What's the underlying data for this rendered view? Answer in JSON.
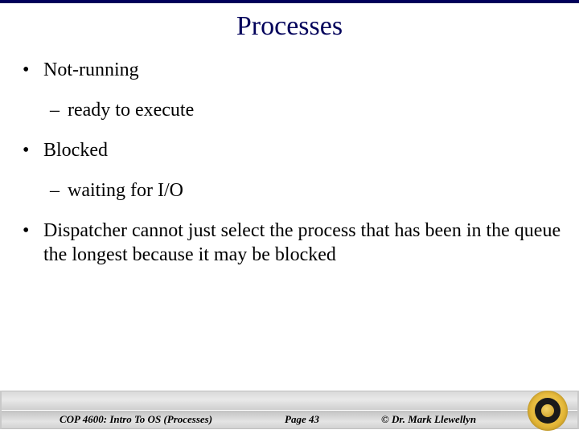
{
  "title": "Processes",
  "bullets": {
    "b1": "Not-running",
    "b1a": "ready to execute",
    "b2": "Blocked",
    "b2a": "waiting for I/O",
    "b3": "Dispatcher cannot just select the process that has been in the queue the longest because it may be blocked"
  },
  "footer": {
    "course": "COP 4600: Intro To OS  (Processes)",
    "page": "Page 43",
    "author": "© Dr. Mark Llewellyn"
  }
}
